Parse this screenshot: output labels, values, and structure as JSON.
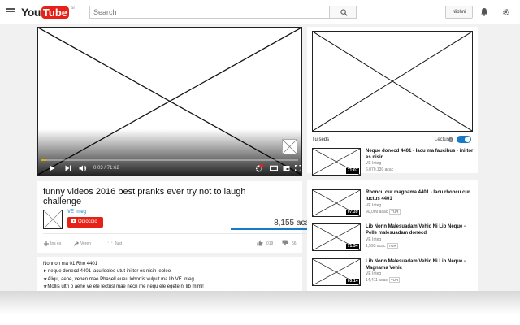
{
  "header": {
    "logo_you": "You",
    "logo_tube": "Tube",
    "logo_region": "SI",
    "search_placeholder": "Search",
    "signin_label": "Nibhni"
  },
  "player": {
    "time": "0:03 / 71:62",
    "progress_fraction": 0.02
  },
  "video": {
    "title": "funny videos 2016 best pranks ever try not to laugh challenge",
    "channel": "VE Integ",
    "subscribe_label": "Odiocdio",
    "views": "8,155 acac",
    "actions": [
      {
        "icon": "add-icon",
        "label": "Ips es"
      },
      {
        "icon": "share-icon",
        "label": "Veren"
      },
      {
        "icon": "more-icon",
        "label": "Just"
      }
    ],
    "likes": "019",
    "dislikes": "56"
  },
  "description": {
    "lines": [
      "Nonnon ma 01 Rho 4401",
      "►neque donecd 4401 iacu leoleo utut ini tor es nisin leoleo",
      "★Aliqu, aene, venen mae Phasell eueu lobortis vulput ma lib VE Integ",
      "★Mollis ultri p aene ve ele lectusl mae necn me nequ ele egete ni lib mimi!"
    ]
  },
  "sidebar": {
    "up_next_label": "Tu seds",
    "autoplay_label": "Lectusle",
    "autoplay_on": true,
    "recommendations": [
      {
        "title": "Neque donecd 4401 - Iacu ma faucibus - ini tor es nisin",
        "channel": "VE Integ",
        "views": "6,070,130 acac",
        "tag": "",
        "duration": "71:07"
      },
      {
        "title": "Rhoncu cur magnama 4401 - Iacu rhoncu cur luctus 4401",
        "channel": "VE Integ",
        "views": "90,009 acac",
        "tag": "TUR",
        "duration": "07:39"
      },
      {
        "title": "Lib Nonn Malesuadam Vehic Ni Lib Neque - Pelle malesuadam donecd",
        "channel": "VE Integ",
        "views": "1,593 acac",
        "tag": "TUR",
        "duration": "71:34"
      },
      {
        "title": "Lib Nonn Malesuadam Vehic Ni Lib Neque - Magnama Vehic",
        "channel": "VE Integ",
        "views": "14,411 acac",
        "tag": "TUR",
        "duration": "03:14"
      }
    ]
  },
  "colors": {
    "brand_red": "#e62117",
    "link_blue": "#167ac6",
    "page_bg": "#f1f1f1",
    "progress_yellow": "#d8b400"
  }
}
